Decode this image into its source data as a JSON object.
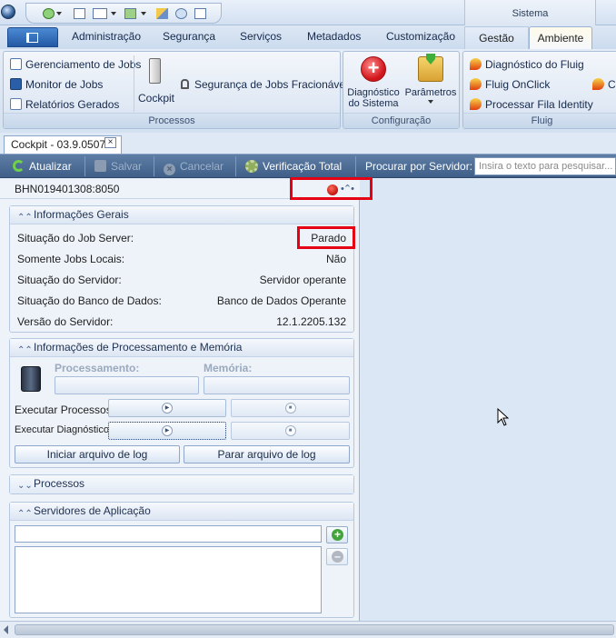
{
  "ribbon": {
    "contextual_group": "Sistema",
    "tabs": [
      "Administração",
      "Segurança",
      "Serviços",
      "Metadados",
      "Customização",
      "Gestão",
      "Ambiente"
    ],
    "active_tab": "Ambiente",
    "processos": {
      "title": "Processos",
      "items": [
        "Gerenciamento de Jobs",
        "Monitor de Jobs",
        "Relatórios Gerados"
      ],
      "cockpit": "Cockpit",
      "seguranca_jobs": "Segurança de Jobs Fracionáveis"
    },
    "configuracao": {
      "title": "Configuração",
      "diagnostico_line1": "Diagnóstico",
      "diagnostico_line2": "do Sistema",
      "parametros": "Parâmetros"
    },
    "fluig": {
      "title": "Fluig",
      "items": [
        "Diagnóstico do Fluig",
        "Fluig OnClick",
        "Processar Fila Identity"
      ],
      "cut_item": "Co"
    }
  },
  "document_tab": {
    "label": "Cockpit - 03.9.0507",
    "close": "×"
  },
  "toolbar": {
    "atualizar": "Atualizar",
    "salvar": "Salvar",
    "cancelar": "Cancelar",
    "verificacao_total": "Verificação Total",
    "procurar_label": "Procurar por Servidor:",
    "search_placeholder": "Insira o texto para pesquisar..."
  },
  "server": {
    "host": "BHN019401308:8050",
    "status_color": "#c0150e"
  },
  "informacoes_gerais": {
    "title": "Informações Gerais",
    "rows": [
      {
        "label": "Situação do Job Server:",
        "value": "Parado"
      },
      {
        "label": "Somente Jobs Locais:",
        "value": "Não"
      },
      {
        "label": "Situação do Servidor:",
        "value": "Servidor operante"
      },
      {
        "label": "Situação do Banco de Dados:",
        "value": "Banco de Dados Operante"
      },
      {
        "label": "Versão do Servidor:",
        "value": "12.1.2205.132"
      }
    ]
  },
  "processamento": {
    "title": "Informações de Processamento e Memória",
    "processamento_label": "Processamento:",
    "memoria_label": "Memória:",
    "executar_processos": "Executar Processos:",
    "executar_diagnostico": "Executar Diagnóstico:",
    "iniciar_log": "Iniciar arquivo de log",
    "parar_log": "Parar arquivo de log"
  },
  "processos_section": {
    "title": "Processos"
  },
  "servidores": {
    "title": "Servidores de Aplicação",
    "input_value": ""
  },
  "colors": {
    "accent": "#2459a4",
    "highlight": "#e60014",
    "toolbar": "#4a6a94"
  }
}
